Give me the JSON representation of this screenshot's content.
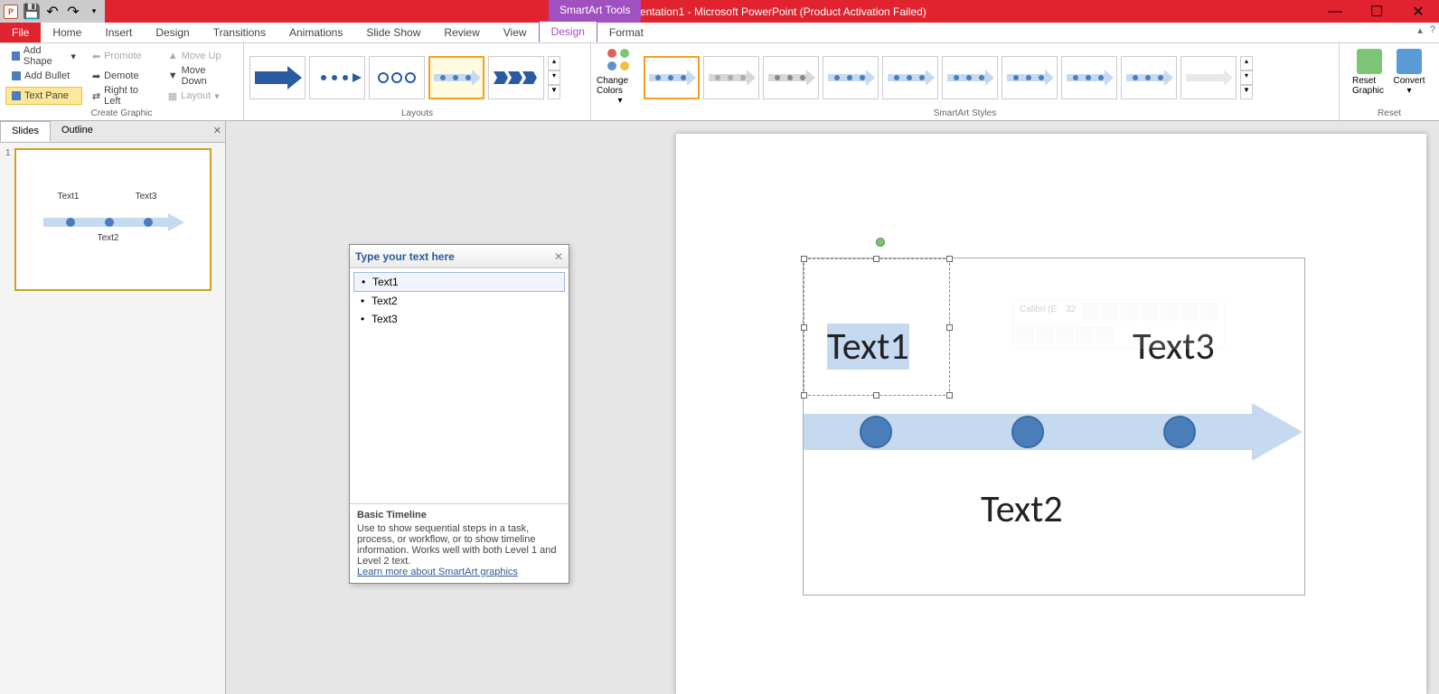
{
  "title": "Presentation1 - Microsoft PowerPoint (Product Activation Failed)",
  "smartart_tools": "SmartArt Tools",
  "tabs": {
    "file": "File",
    "home": "Home",
    "insert": "Insert",
    "design_main": "Design",
    "transitions": "Transitions",
    "animations": "Animations",
    "slideshow": "Slide Show",
    "review": "Review",
    "view": "View",
    "design": "Design",
    "format": "Format"
  },
  "ribbon": {
    "create_graphic": {
      "add_shape": "Add Shape",
      "add_bullet": "Add Bullet",
      "text_pane": "Text Pane",
      "promote": "Promote",
      "demote": "Demote",
      "right_to_left": "Right to Left",
      "move_up": "Move Up",
      "move_down": "Move Down",
      "layout": "Layout",
      "label": "Create Graphic"
    },
    "layouts_label": "Layouts",
    "change_colors": "Change Colors",
    "styles_label": "SmartArt Styles",
    "reset": {
      "reset_graphic": "Reset Graphic",
      "convert": "Convert",
      "label": "Reset"
    }
  },
  "slide_panel": {
    "slides": "Slides",
    "outline": "Outline",
    "num": "1"
  },
  "text_pane": {
    "header": "Type your text here",
    "items": [
      "Text1",
      "Text2",
      "Text3"
    ],
    "footer_title": "Basic Timeline",
    "footer_desc": "Use to show sequential steps in a task, process, or workflow, or to show timeline information. Works well with both Level 1 and Level 2 text.",
    "learn_more": "Learn more about SmartArt graphics"
  },
  "smartart": {
    "t1": "Text1",
    "t2": "Text2",
    "t3": "Text3"
  },
  "mini_toolbar": {
    "font": "Calibri (E",
    "size": "32"
  }
}
